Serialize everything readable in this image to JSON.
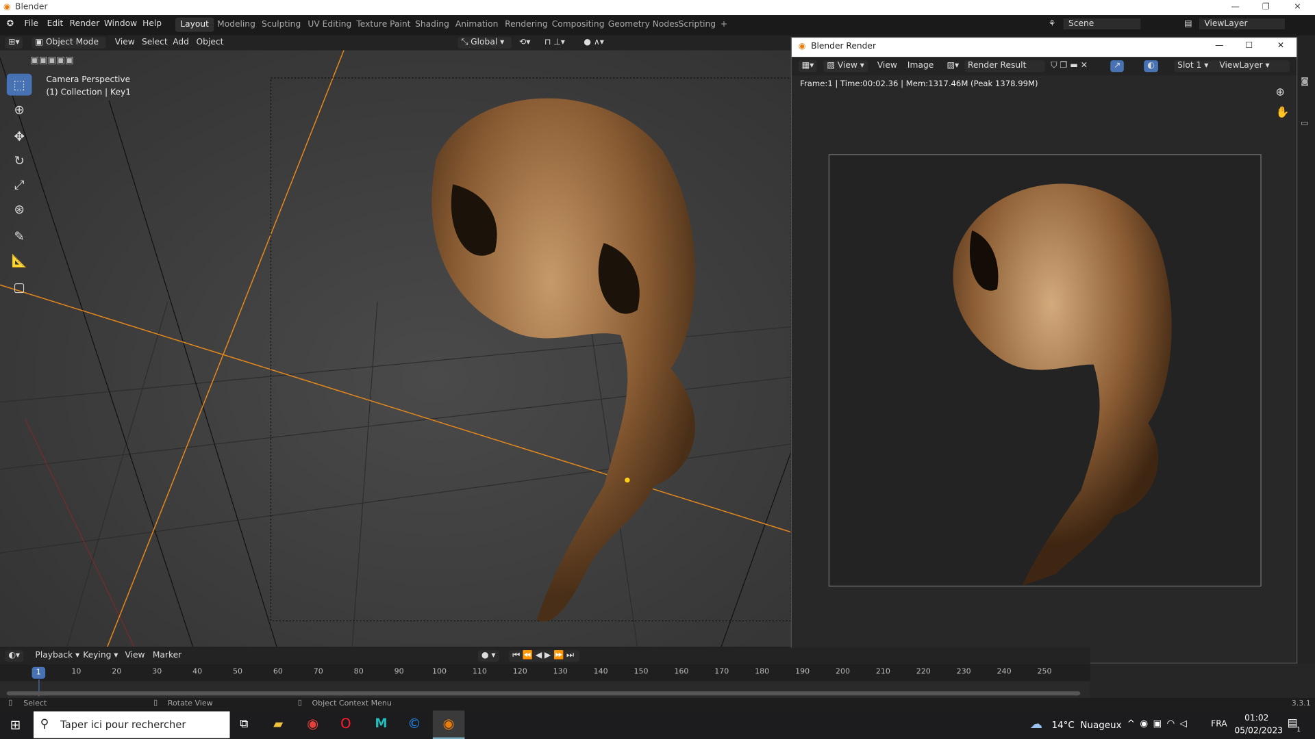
{
  "window": {
    "title": "Blender"
  },
  "menu": [
    "File",
    "Edit",
    "Render",
    "Window",
    "Help"
  ],
  "workspaces": [
    "Layout",
    "Modeling",
    "Sculpting",
    "UV Editing",
    "Texture Paint",
    "Shading",
    "Animation",
    "Rendering",
    "Compositing",
    "Geometry Nodes",
    "Scripting",
    "+"
  ],
  "scene": {
    "name": "Scene",
    "view_layer": "ViewLayer"
  },
  "viewport_header": {
    "mode": "Object Mode",
    "menus": [
      "View",
      "Select",
      "Add",
      "Object"
    ],
    "orientation": "Global"
  },
  "viewport": {
    "camera_label": "Camera Perspective",
    "collection_label": "(1) Collection | Key1"
  },
  "render_window": {
    "title": "Blender Render",
    "view_dropdown": "View",
    "menus": [
      "View",
      "Image"
    ],
    "image_name": "Render Result",
    "slot": "Slot 1",
    "view_layer": "ViewLayer",
    "info": "Frame:1 | Time:00:02.36 | Mem:1317.46M (Peak 1378.99M)"
  },
  "timeline": {
    "menus": [
      "Playback",
      "Keying",
      "View",
      "Marker"
    ],
    "current_frame": "1",
    "ticks": [
      "10",
      "20",
      "30",
      "40",
      "50",
      "60",
      "70",
      "80",
      "90",
      "100",
      "110",
      "120",
      "130",
      "140",
      "150",
      "160",
      "170",
      "180",
      "190",
      "200",
      "210",
      "220",
      "230",
      "240",
      "250"
    ]
  },
  "statusbar": {
    "select": "Select",
    "rotate": "Rotate View",
    "context": "Object Context Menu",
    "version": "3.3.1"
  },
  "taskbar": {
    "search_placeholder": "Taper ici pour rechercher",
    "weather": "14°C  Nuageux",
    "lang": "FRA",
    "time": "01:02",
    "date": "05/02/2023",
    "notifications": "1"
  }
}
